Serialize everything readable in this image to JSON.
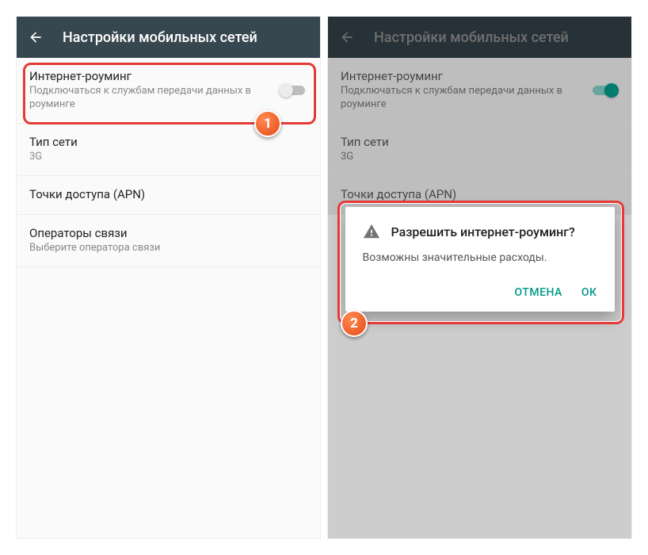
{
  "left": {
    "header_title": "Настройки мобильных сетей",
    "roaming": {
      "title": "Интернет-роуминг",
      "sub": "Подключаться к службам передачи данных в роуминге"
    },
    "network_type": {
      "title": "Тип сети",
      "sub": "3G"
    },
    "apn": {
      "title": "Точки доступа (APN)"
    },
    "operators": {
      "title": "Операторы связи",
      "sub": "Выберите оператора связи"
    }
  },
  "right": {
    "header_title": "Настройки мобильных сетей",
    "roaming": {
      "title": "Интернет-роуминг",
      "sub": "Подключаться к службам передачи данных в роуминге"
    },
    "network_type": {
      "title": "Тип сети",
      "sub": "3G"
    },
    "apn": {
      "title": "Точки доступа (APN)"
    },
    "dialog": {
      "title": "Разрешить интернет-роуминг?",
      "message": "Возможны значительные расходы.",
      "cancel": "ОТМЕНА",
      "ok": "ОК"
    }
  },
  "badges": {
    "one": "1",
    "two": "2"
  }
}
